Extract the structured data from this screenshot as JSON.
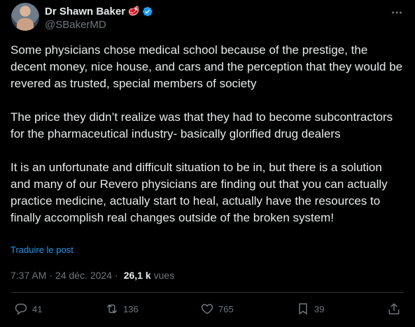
{
  "author": {
    "display_name": "Dr Shawn Baker",
    "emoji": "🥩",
    "handle": "@SBakerMD",
    "verified": true
  },
  "body": {
    "paragraphs": [
      "Some physicians chose medical school because of the prestige, the decent money, nice house, and cars and the perception that they would be revered as trusted, special members of society",
      "The price they didn’t realize was that they had to become subcontractors for the pharmaceutical industry- basically glorified drug dealers",
      "It is an unfortunate and difficult situation to be in, but there is a solution and many of our Revero physicians are finding out that you can actually practice medicine, actually start to heal, actually have the resources to finally accomplish real changes outside of the broken system!"
    ]
  },
  "translate_label": "Traduire le post",
  "meta": {
    "time": "7:37 AM",
    "separator": "·",
    "date": "24 déc. 2024",
    "views_count": "26,1 k",
    "views_label": "vues"
  },
  "actions": {
    "replies": "41",
    "reposts": "136",
    "likes": "765",
    "bookmarks": "39"
  },
  "icons": {
    "more": "more-horizontal-icon",
    "verified": "verified-badge-icon",
    "reply": "reply-icon",
    "repost": "repost-icon",
    "like": "heart-icon",
    "bookmark": "bookmark-icon",
    "share": "share-icon"
  },
  "colors": {
    "background": "#000000",
    "text": "#e7e9ea",
    "secondary": "#71767b",
    "accent": "#1d9bf0",
    "divider": "#2f3336"
  }
}
